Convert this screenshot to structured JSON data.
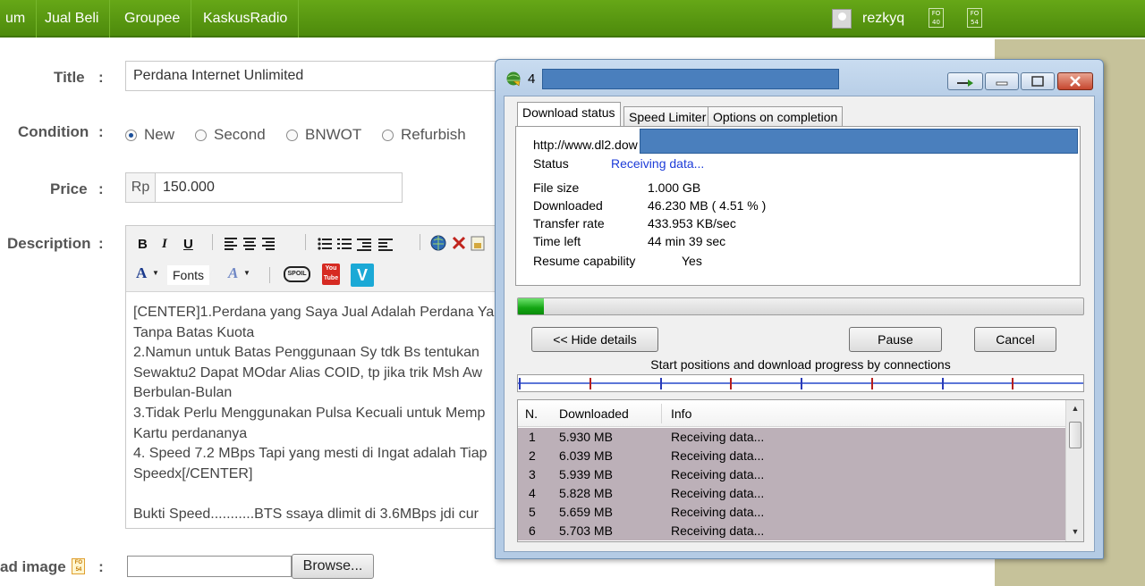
{
  "nav": {
    "items": [
      "um",
      "Jual Beli",
      "Groupee",
      "KaskusRadio"
    ],
    "username": "rezkyq",
    "badge1": "FO 40",
    "badge2": "FO 54"
  },
  "form": {
    "title_label": "Title",
    "title_value": "Perdana Internet Unlimited",
    "condition_label": "Condition",
    "conditions": [
      {
        "label": "New",
        "selected": true
      },
      {
        "label": "Second",
        "selected": false
      },
      {
        "label": "BNWOT",
        "selected": false
      },
      {
        "label": "Refurbish",
        "selected": false
      }
    ],
    "price_label": "Price",
    "price_prefix": "Rp",
    "price_value": "150.000",
    "description_label": "Description",
    "colon": ":",
    "toolbar": {
      "bold": "B",
      "italic": "I",
      "underline": "U",
      "font_color": "A",
      "fonts": "Fonts",
      "spoiler": "SPOIL",
      "youtube": "You Tube",
      "vimeo": "V"
    },
    "description_lines": [
      "[CENTER]1.Perdana yang Saya Jual Adalah Perdana Ya",
      "Tanpa Batas Kuota",
      "2.Namun untuk Batas Penggunaan Sy tdk Bs tentukan",
      "Sewaktu2 Dapat MOdar Alias COID, tp jika trik Msh Aw",
      "Berbulan-Bulan",
      "3.Tidak Perlu Menggunakan Pulsa Kecuali untuk Memp",
      "Kartu perdananya",
      "4. Speed 7.2 MBps Tapi yang mesti di Ingat adalah Tiap",
      "Speedx[/CENTER]",
      "",
      "Bukti Speed...........BTS ssaya dlimit di 3.6MBps jdi cur"
    ],
    "upload_label": "ad image",
    "browse_label": "Browse..."
  },
  "idm": {
    "title_prefix": "4",
    "tabs": [
      "Download status",
      "Speed Limiter",
      "Options on completion"
    ],
    "url": "http://www.dl2.dow",
    "status_label": "Status",
    "status_value": "Receiving data...",
    "file_size_label": "File size",
    "file_size_value": "1.000  GB",
    "downloaded_label": "Downloaded",
    "downloaded_value": "46.230  MB  ( 4.51 % )",
    "transfer_rate_label": "Transfer rate",
    "transfer_rate_value": "433.953  KB/sec",
    "time_left_label": "Time left",
    "time_left_value": "44 min 39 sec",
    "resume_label": "Resume capability",
    "resume_value": "Yes",
    "progress_fraction": 0.0451,
    "hide_details_label": "<< Hide details",
    "pause_label": "Pause",
    "cancel_label": "Cancel",
    "connections_label": "Start positions and download progress by connections",
    "list_headers": [
      "N.",
      "Downloaded",
      "Info"
    ],
    "connections": [
      {
        "n": "1",
        "downloaded": "5.930  MB",
        "info": "Receiving data..."
      },
      {
        "n": "2",
        "downloaded": "6.039  MB",
        "info": "Receiving data..."
      },
      {
        "n": "3",
        "downloaded": "5.939  MB",
        "info": "Receiving data..."
      },
      {
        "n": "4",
        "downloaded": "5.828  MB",
        "info": "Receiving data..."
      },
      {
        "n": "5",
        "downloaded": "5.659  MB",
        "info": "Receiving data..."
      },
      {
        "n": "6",
        "downloaded": "5.703  MB",
        "info": "Receiving data..."
      }
    ]
  }
}
